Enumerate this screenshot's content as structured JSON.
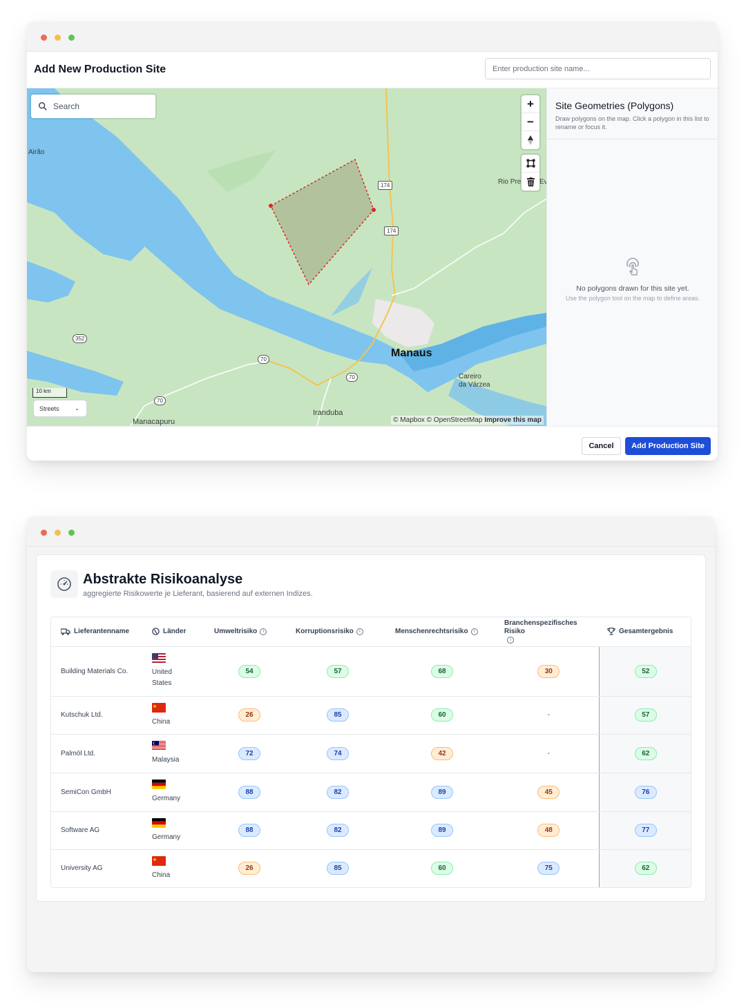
{
  "window1": {
    "title": "Add New Production Site",
    "name_input": {
      "placeholder": "Enter production site name...",
      "value": ""
    },
    "map": {
      "search_placeholder": "Search",
      "zoom_in": "+",
      "zoom_out": "−",
      "labels": {
        "airao": "Airão",
        "manaus": "Manaus",
        "careiro": "Careiro\nda Várzea",
        "iranduba": "Iranduba",
        "manacapuru": "Manacapuru",
        "rio_pre": "Rio Pre",
        "ev": "Ev"
      },
      "road_shields": [
        "174",
        "174",
        "352",
        "70",
        "70",
        "70"
      ],
      "scale": "10 km",
      "style_select": "Streets",
      "attribution_prefix": "© Mapbox © OpenStreetMap",
      "attribution_link": "Improve this map"
    },
    "sidebar": {
      "title": "Site Geometries (Polygons)",
      "description": "Draw polygons on the map. Click a polygon in this list to rename or focus it.",
      "empty_title": "No polygons drawn for this site yet.",
      "empty_hint": "Use the polygon tool on the map to define areas."
    },
    "footer": {
      "cancel": "Cancel",
      "submit": "Add Production Site"
    },
    "colors": {
      "primary": "#1d4ed8",
      "polygon_stroke": "#dc2626"
    }
  },
  "window2": {
    "title": "Abstrakte Risikoanalyse",
    "subtitle": "aggregierte Risikowerte je Lieferant, basierend auf externen Indizes.",
    "columns": {
      "supplier": "Lieferantenname",
      "countries": "Länder",
      "environment": "Umweltrisiko",
      "corruption": "Korruptionsrisiko",
      "human_rights": "Menschenrechtsrisiko",
      "industry": "Branchenspezifisches Risiko",
      "total": "Gesamtergebnis"
    },
    "rows": [
      {
        "supplier": "Building Materials Co.",
        "country": "United States",
        "flag": "us",
        "environment": "54",
        "corruption": "57",
        "human_rights": "68",
        "industry": "30",
        "total": "52"
      },
      {
        "supplier": "Kutschuk Ltd.",
        "country": "China",
        "flag": "cn",
        "environment": "26",
        "corruption": "85",
        "human_rights": "60",
        "industry": "-",
        "total": "57"
      },
      {
        "supplier": "Palmöl Ltd.",
        "country": "Malaysia",
        "flag": "my",
        "environment": "72",
        "corruption": "74",
        "human_rights": "42",
        "industry": "-",
        "total": "62"
      },
      {
        "supplier": "SemiCon GmbH",
        "country": "Germany",
        "flag": "de",
        "environment": "88",
        "corruption": "82",
        "human_rights": "89",
        "industry": "45",
        "total": "76"
      },
      {
        "supplier": "Software AG",
        "country": "Germany",
        "flag": "de",
        "environment": "88",
        "corruption": "82",
        "human_rights": "89",
        "industry": "48",
        "total": "77"
      },
      {
        "supplier": "University AG",
        "country": "China",
        "flag": "cn",
        "environment": "26",
        "corruption": "85",
        "human_rights": "60",
        "industry": "75",
        "total": "62"
      }
    ],
    "badge_colors": {
      "low": "#dcfce7",
      "medium": "#ffedd5",
      "high": "#dbeafe"
    }
  }
}
